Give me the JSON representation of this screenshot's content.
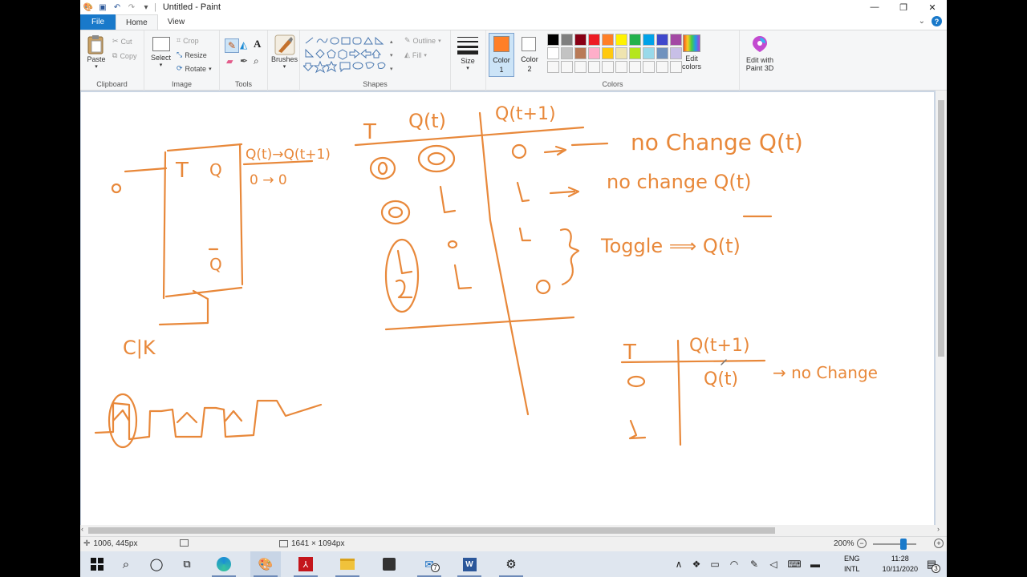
{
  "window": {
    "title": "Untitled - Paint"
  },
  "tabs": {
    "file": "File",
    "home": "Home",
    "view": "View"
  },
  "clipboard": {
    "paste": "Paste",
    "cut": "Cut",
    "copy": "Copy",
    "label": "Clipboard"
  },
  "image": {
    "select": "Select",
    "crop": "Crop",
    "resize": "Resize",
    "rotate": "Rotate",
    "label": "Image"
  },
  "tools": {
    "label": "Tools"
  },
  "brushes": {
    "label": "Brushes"
  },
  "shapes": {
    "outline": "Outline",
    "fill": "Fill",
    "label": "Shapes"
  },
  "size": {
    "label": "Size"
  },
  "colors": {
    "color1_label": "Color",
    "color1_num": "1",
    "color2_label": "Color",
    "color2_num": "2",
    "edit_line1": "Edit",
    "edit_line2": "colors",
    "paint3d_line1": "Edit with",
    "paint3d_line2": "Paint 3D",
    "label": "Colors",
    "color1_value": "#ff7f27",
    "color2_value": "#ffffff",
    "palette_row1": [
      "#000000",
      "#7f7f7f",
      "#880015",
      "#ed1c24",
      "#ff7f27",
      "#fff200",
      "#22b14c",
      "#00a2e8",
      "#3f48cc",
      "#a349a4"
    ],
    "palette_row2": [
      "#ffffff",
      "#c3c3c3",
      "#b97a57",
      "#ffaec9",
      "#ffc90e",
      "#efe4b0",
      "#b5e61d",
      "#99d9ea",
      "#7092be",
      "#c8bfe7"
    ]
  },
  "status": {
    "cursor": "1006, 445px",
    "canvas_size": "1641 × 1094px",
    "zoom": "200%"
  },
  "taskbar": {
    "lang1": "ENG",
    "lang2": "INTL",
    "time": "11:28",
    "date": "10/11/2020",
    "mail_badge": "7",
    "notif_badge": "3"
  },
  "drawing": {
    "h_T1": "T",
    "h_Qt1": "Q(t)",
    "h_Qt11": "Q(t+1)",
    "r1_note": "no Change Q(t)",
    "r2_note": "no change Q(t)",
    "toggle": "Toggle ⟹ Q(t)",
    "ff_T": "T",
    "ff_Q": "Q",
    "ff_Qbar": "Q",
    "ff_hdr": "Q(t)→Q(t+1)",
    "ff_r1": "0 → 0",
    "clk": "C|K",
    "h_T2": "T",
    "h_Qt12": "Q(t+1)",
    "t2_Qt": "Q(t)",
    "t2_note": "→ no Change"
  }
}
